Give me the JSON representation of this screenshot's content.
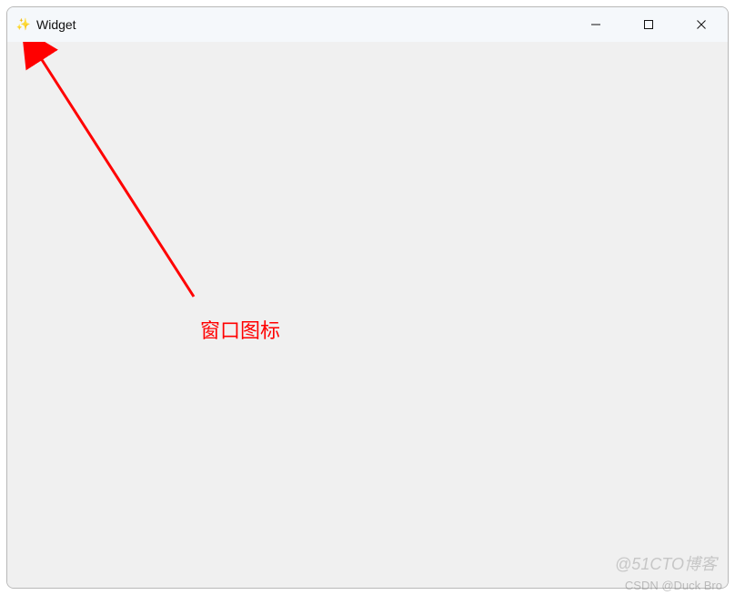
{
  "window": {
    "title": "Widget",
    "icon_glyph": "✨",
    "controls": {
      "minimize_label": "Minimize",
      "maximize_label": "Maximize",
      "close_label": "Close"
    }
  },
  "annotation": {
    "label": "窗口图标",
    "color": "#ff0000"
  },
  "watermarks": {
    "top": "@51CTO博客",
    "bottom": "CSDN @Duck Bro"
  }
}
